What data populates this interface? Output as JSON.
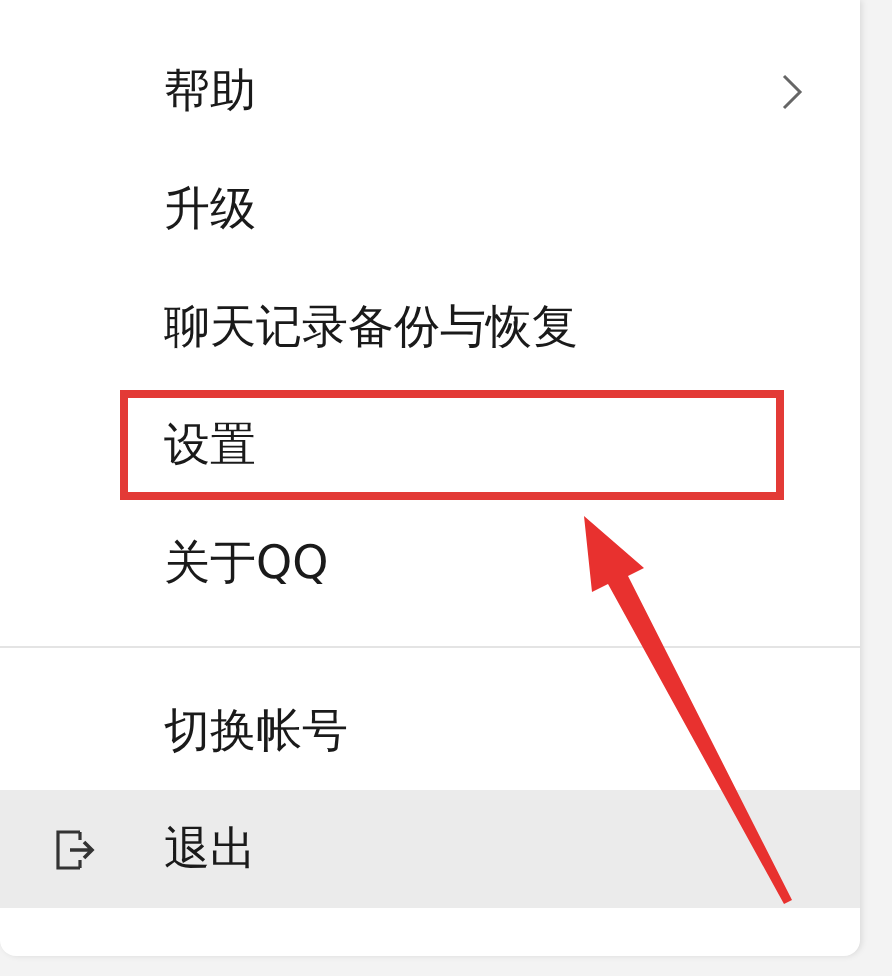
{
  "menu": {
    "groups": [
      {
        "items": [
          {
            "kind": "text",
            "label": "帮助",
            "submenu": true,
            "hovered": false,
            "highlighted": false
          },
          {
            "kind": "text",
            "label": "升级",
            "submenu": false,
            "hovered": false,
            "highlighted": false
          },
          {
            "kind": "text",
            "label": "聊天记录备份与恢复",
            "submenu": false,
            "hovered": false,
            "highlighted": false
          },
          {
            "kind": "text",
            "label": "设置",
            "submenu": false,
            "hovered": false,
            "highlighted": true
          },
          {
            "kind": "text",
            "label": "关于QQ",
            "submenu": false,
            "hovered": false,
            "highlighted": false
          }
        ]
      },
      {
        "items": [
          {
            "kind": "text",
            "label": "切换帐号",
            "submenu": false,
            "hovered": false,
            "highlighted": false
          },
          {
            "kind": "exit",
            "label": "退出",
            "submenu": false,
            "hovered": true,
            "highlighted": false
          }
        ]
      }
    ]
  }
}
